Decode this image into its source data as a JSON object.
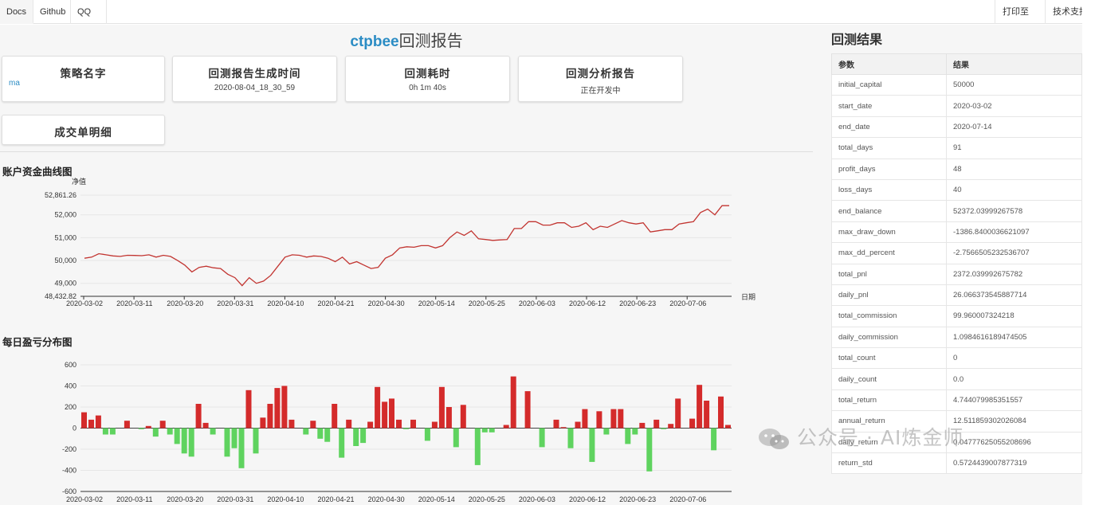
{
  "nav": {
    "tabs": [
      "Docs",
      "Github",
      "QQ群"
    ],
    "tools": [
      "打印至pdf",
      "技术支持"
    ]
  },
  "report": {
    "brand": "ctpbee",
    "title_suffix": "回测报告"
  },
  "cards": {
    "strategy_name": {
      "title": "策略名字",
      "value": "ma"
    },
    "gen_time": {
      "title": "回测报告生成时间",
      "value": "2020-08-04_18_30_59"
    },
    "elapsed": {
      "title": "回测耗时",
      "value": "0h 1m 40s"
    },
    "analysis": {
      "title": "回测分析报告",
      "value": "正在开发中"
    },
    "trades": {
      "title": "成交单明细"
    }
  },
  "sections": {
    "equity": "账户资金曲线图",
    "daily_pnl": "每日盈亏分布图"
  },
  "results": {
    "title": "回测结果",
    "headers": [
      "参数",
      "结果"
    ],
    "rows": [
      [
        "initial_capital",
        "50000"
      ],
      [
        "start_date",
        "2020-03-02"
      ],
      [
        "end_date",
        "2020-07-14"
      ],
      [
        "total_days",
        "91"
      ],
      [
        "profit_days",
        "48"
      ],
      [
        "loss_days",
        "40"
      ],
      [
        "end_balance",
        "52372.03999267578"
      ],
      [
        "max_draw_down",
        "-1386.8400036621097"
      ],
      [
        "max_dd_percent",
        "-2.7566505232536707"
      ],
      [
        "total_pnl",
        "2372.039992675782"
      ],
      [
        "daily_pnl",
        "26.066373545887714"
      ],
      [
        "total_commission",
        "99.960007324218"
      ],
      [
        "daily_commission",
        "1.0984616189474505"
      ],
      [
        "total_count",
        "0"
      ],
      [
        "daily_count",
        "0.0"
      ],
      [
        "total_return",
        "4.744079985351557"
      ],
      [
        "annual_return",
        "12.511859302026084"
      ],
      [
        "daily_return",
        "0.04777625055208696"
      ],
      [
        "return_std",
        "0.5724439007877319"
      ]
    ]
  },
  "watermark": "公众号 · AI炼金师",
  "colors": {
    "line": "#c23531",
    "profit": "#d42b2b",
    "loss": "#5fd35f",
    "brand": "#2b8cc4"
  },
  "chart_data": [
    {
      "type": "line",
      "ylabel": "净值",
      "xlabel": "日期",
      "ylim": [
        48432.82,
        52861.26
      ],
      "y_ticks": [
        "52,861.26",
        "52,000",
        "51,000",
        "50,000",
        "49,000",
        "48,432.82"
      ],
      "x_ticks": [
        "2020-03-02",
        "2020-03-11",
        "2020-03-20",
        "2020-03-31",
        "2020-04-10",
        "2020-04-21",
        "2020-04-30",
        "2020-05-14",
        "2020-05-25",
        "2020-06-03",
        "2020-06-12",
        "2020-06-23",
        "2020-07-06"
      ],
      "grid": true,
      "values": [
        50100,
        50150,
        50300,
        50250,
        50200,
        50180,
        50230,
        50220,
        50210,
        50250,
        50150,
        50230,
        50180,
        50000,
        49800,
        49500,
        49700,
        49750,
        49680,
        49650,
        49400,
        49250,
        48900,
        49250,
        49000,
        49100,
        49350,
        49750,
        50150,
        50250,
        50230,
        50150,
        50200,
        50180,
        50100,
        49950,
        50150,
        49850,
        49950,
        49800,
        49650,
        49700,
        50100,
        50250,
        50550,
        50600,
        50580,
        50650,
        50650,
        50550,
        50650,
        51000,
        51250,
        51100,
        51300,
        50950,
        50920,
        50880,
        50900,
        50920,
        51400,
        51400,
        51700,
        51700,
        51550,
        51550,
        51650,
        51650,
        51450,
        51500,
        51650,
        51350,
        51500,
        51450,
        51600,
        51750,
        51650,
        51600,
        51650,
        51250,
        51300,
        51350,
        51350,
        51600,
        51650,
        51700,
        52100,
        52250,
        52000,
        52400,
        52400
      ]
    },
    {
      "type": "bar",
      "ylim": [
        -600,
        600
      ],
      "y_ticks": [
        "600",
        "400",
        "200",
        "0",
        "-200",
        "-400",
        "-600"
      ],
      "x_ticks": [
        "2020-03-02",
        "2020-03-11",
        "2020-03-20",
        "2020-03-31",
        "2020-04-10",
        "2020-04-21",
        "2020-04-30",
        "2020-05-14",
        "2020-05-25",
        "2020-06-03",
        "2020-06-12",
        "2020-06-23",
        "2020-07-06"
      ],
      "grid": true,
      "values": [
        150,
        80,
        120,
        -60,
        -60,
        0,
        70,
        0,
        -10,
        20,
        -80,
        70,
        -60,
        -150,
        -240,
        -270,
        230,
        50,
        -60,
        0,
        -270,
        -190,
        -380,
        360,
        -240,
        100,
        230,
        380,
        400,
        80,
        0,
        -60,
        70,
        -100,
        -130,
        230,
        -280,
        80,
        -170,
        -140,
        60,
        390,
        250,
        280,
        80,
        -10,
        80,
        0,
        -120,
        60,
        390,
        200,
        -180,
        220,
        0,
        -350,
        -40,
        -40,
        0,
        30,
        490,
        0,
        350,
        0,
        -180,
        0,
        80,
        10,
        -190,
        60,
        180,
        -320,
        160,
        -60,
        180,
        180,
        -150,
        -60,
        50,
        -410,
        80,
        -10,
        40,
        280,
        0,
        90,
        410,
        260,
        -210,
        300,
        30
      ]
    }
  ]
}
